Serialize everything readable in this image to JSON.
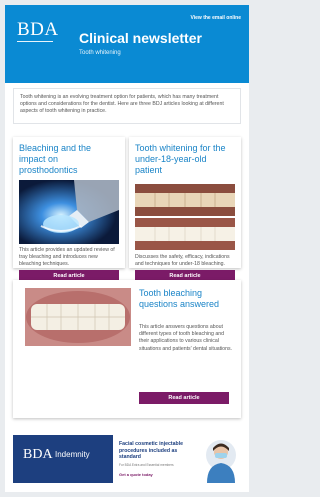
{
  "header": {
    "logo": "BDA",
    "view_link": "View the email online",
    "title": "Clinical newsletter",
    "subtitle": "Tooth whitening"
  },
  "intro": {
    "text": "Tooth whitening is an evolving treatment option for patients, which has many treatment options and considerations for the dentist. Here are three BDJ articles looking at different aspects of tooth whitening in practice."
  },
  "articles": [
    {
      "title": "Bleaching and the impact on prosthodontics",
      "text": "This article provides an updated review of tray bleaching and introduces new bleaching techniques.",
      "button": "Read article"
    },
    {
      "title": "Tooth whitening for the under-18-year-old patient",
      "text": "Discusses the safety, efficacy, indications and techniques for under-18 bleaching.",
      "button": "Read article"
    },
    {
      "title": "Tooth bleaching questions answered",
      "text": "This article answers questions about different types of tooth bleaching and their applications to various clinical situations and patients' dental situations.",
      "button": "Read article"
    }
  ],
  "footer": {
    "logo": "BDA",
    "brand": "Indemnity",
    "headline": "Facial cosmetic injectable procedures included as standard",
    "small_print": "For BDA Extra and Essential members",
    "cta": "Get a quote today"
  },
  "colors": {
    "header_blue": "#0a8ad3",
    "title_blue": "#1a84c7",
    "button_purple": "#7b1b67",
    "footer_navy": "#1d3f7f"
  }
}
